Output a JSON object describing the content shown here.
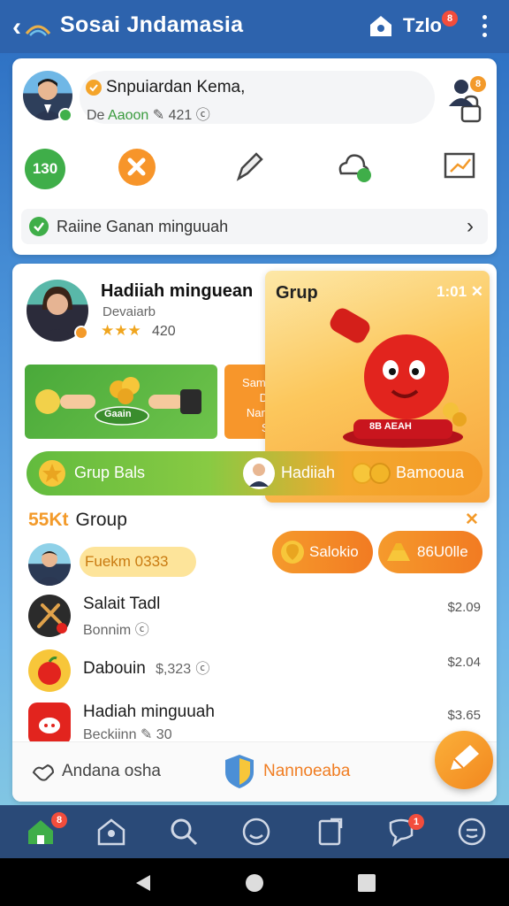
{
  "app": {
    "title": "Sosai Jndamasia",
    "profile_name": "Tzlo",
    "profile_badge": "8"
  },
  "header_card": {
    "username": "Snpuiardan Kema,",
    "stat_label": "De",
    "stat_green": "Aaoon",
    "stat_count": "421",
    "circle_value": "130",
    "person_badge": "8",
    "notice": "Raiine Ganan minguuah"
  },
  "promo": {
    "title": "Hadiiah minguean",
    "subtitle": "Devaiarb",
    "stars": "★★★",
    "stars_count": "420",
    "banner_label": "Gaain",
    "orange_box": [
      "Sama Wagla",
      "Dama",
      "Nana Vean",
      "San?"
    ],
    "grup_label": "Grup",
    "grup_time": "1:01",
    "mascot_label": "8B AEAH",
    "bar_left": "Grup Bals",
    "bar_mid": "Hadiiah",
    "bar_right": "Bamooua"
  },
  "group": {
    "num": "55Kt",
    "title": "Group",
    "user_pill": "Fuekm 0333",
    "pill1": "Salokio",
    "pill2": "86U0lle"
  },
  "list": [
    {
      "title": "Salait Tadl",
      "sub": "Bonnim",
      "price": "$2.09"
    },
    {
      "title": "Dabouin",
      "sub": "$,323",
      "price": "$2.04"
    },
    {
      "title": "Hadiah minguuah",
      "sub": "Beckiinn",
      "sub_count": "30",
      "price": "$3.65"
    }
  ],
  "bottom_panel": {
    "left_label": "Andana osha",
    "right_label": "Nannoeaba"
  },
  "nav": {
    "home_badge": "8",
    "chat_badge": "1"
  },
  "colors": {
    "primary_blue": "#2d63ad",
    "accent_orange": "#f39a2a",
    "accent_green": "#3fae49"
  }
}
